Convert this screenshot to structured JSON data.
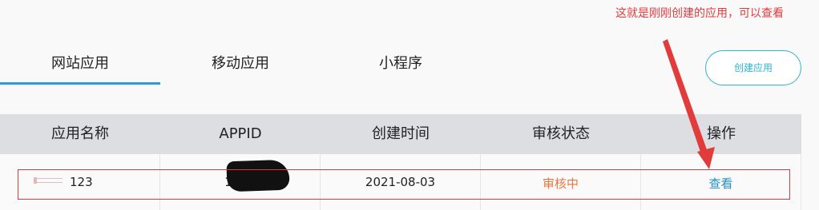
{
  "annotation": "这就是刚刚创建的应用，可以查看",
  "tabs": [
    {
      "label": "网站应用",
      "active": true
    },
    {
      "label": "移动应用",
      "active": false
    },
    {
      "label": "小程序",
      "active": false
    }
  ],
  "create_button": "创建应用",
  "table": {
    "headers": [
      "应用名称",
      "APPID",
      "创建时间",
      "审核状态",
      "操作"
    ],
    "rows": [
      {
        "name": "123",
        "appid": "101",
        "created": "2021-08-03",
        "status": "审核中",
        "action": "查看"
      }
    ]
  },
  "colors": {
    "accent": "#2d9bd8",
    "create_button": "#2fb5c8",
    "status_pending": "#e8763e",
    "link": "#1f8fca",
    "annotation": "#e23b3b"
  }
}
